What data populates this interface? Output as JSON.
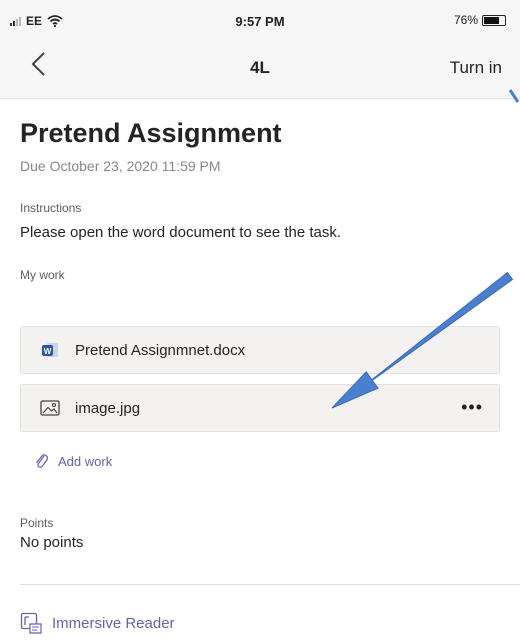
{
  "status_bar": {
    "carrier": "EE",
    "time": "9:57 PM",
    "battery": "76%",
    "battery_level": 0.76
  },
  "nav": {
    "back_icon": "chevron-left-icon",
    "title": "4L",
    "turn_in_label": "Turn in"
  },
  "assignment": {
    "title": "Pretend Assignment",
    "due": "Due October 23, 2020 11:59 PM"
  },
  "instructions": {
    "label": "Instructions",
    "text": "Please open the word document to see the task."
  },
  "my_work": {
    "label": "My work",
    "files": [
      {
        "name": "Pretend Assignmnet.docx",
        "icon": "word-document-icon"
      },
      {
        "name": "image.jpg",
        "icon": "image-icon",
        "more_label": "•••"
      }
    ],
    "add_work_label": "Add work"
  },
  "points": {
    "label": "Points",
    "value": "No points"
  },
  "immersive_reader": {
    "label": "Immersive Reader",
    "icon": "immersive-reader-icon"
  },
  "colors": {
    "accent": "#6264a7",
    "word_blue": "#2b579a",
    "annotation_arrow": "#4a7fd0"
  }
}
